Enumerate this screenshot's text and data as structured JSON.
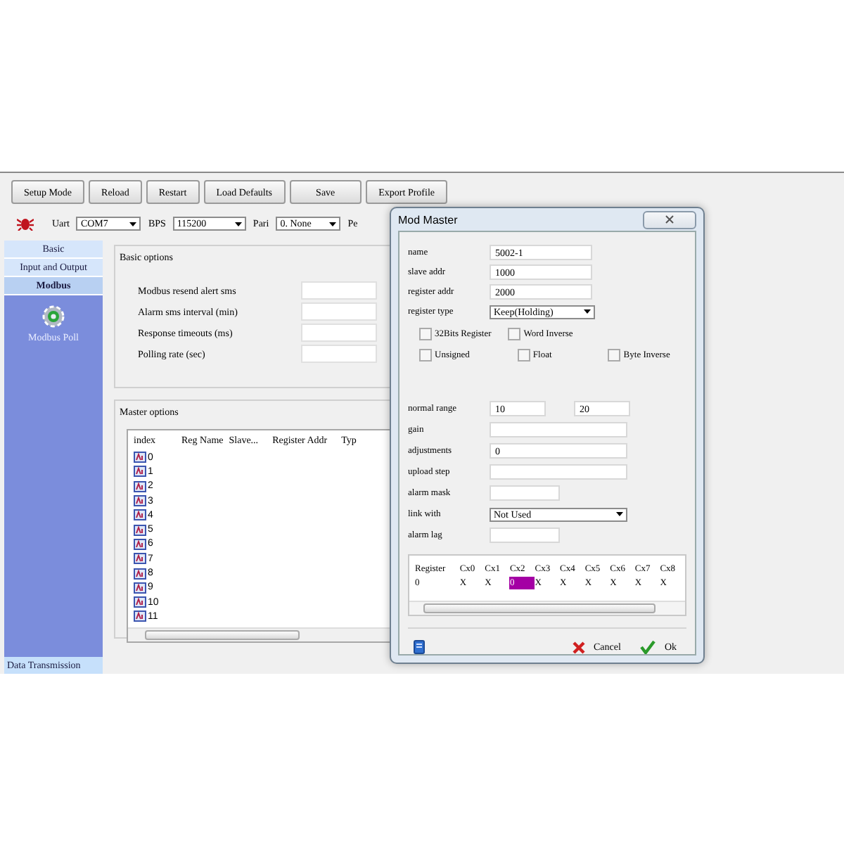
{
  "toolbar": {
    "buttons": [
      "Setup Mode",
      "Reload",
      "Restart",
      "Load Defaults",
      "Save",
      "Export Profile"
    ]
  },
  "port_row": {
    "fields": [
      {
        "label": "Uart",
        "value": "COM7",
        "kind": "select"
      },
      {
        "label": "BPS",
        "value": "115200",
        "kind": "select"
      },
      {
        "label": "Pari",
        "value": "0. None",
        "kind": "select"
      }
    ],
    "cut_label": "Pe"
  },
  "sidebar": {
    "items": [
      {
        "label": "Basic",
        "selected": false
      },
      {
        "label": "Input and Output",
        "selected": false
      },
      {
        "label": "Modbus",
        "selected": true
      }
    ],
    "tools": [
      {
        "label": "Modbus Poll"
      }
    ],
    "footer": "Data Transmission"
  },
  "basic_options": {
    "title": "Basic options",
    "fields": [
      {
        "label": "Modbus resend alert sms"
      },
      {
        "label": "Alarm sms interval (min)"
      },
      {
        "label": "Response timeouts (ms)"
      },
      {
        "label": "Polling rate (sec)"
      }
    ]
  },
  "master_options": {
    "title": "Master options",
    "columns": [
      "index",
      "Reg Name",
      "Slave...",
      "Register Addr",
      "Typ"
    ],
    "rows": [
      {
        "index": "0"
      },
      {
        "index": "1"
      },
      {
        "index": "2"
      },
      {
        "index": "3"
      },
      {
        "index": "4"
      },
      {
        "index": "5"
      },
      {
        "index": "6"
      },
      {
        "index": "7"
      },
      {
        "index": "8"
      },
      {
        "index": "9"
      },
      {
        "index": "10"
      },
      {
        "index": "11"
      }
    ]
  },
  "dialog": {
    "title": "Mod Master",
    "top_fields": [
      {
        "label": "name",
        "value": "5002-1",
        "kind": "text"
      },
      {
        "label": "slave addr",
        "value": "1000",
        "kind": "text"
      },
      {
        "label": "register addr",
        "value": "2000",
        "kind": "text"
      },
      {
        "label": "register type",
        "value": "Keep(Holding)",
        "kind": "select"
      }
    ],
    "options": [
      [
        {
          "label": "32Bits Register",
          "checked": false
        },
        {
          "label": "Word Inverse",
          "checked": false
        }
      ],
      [
        {
          "label": "Unsigned",
          "checked": false
        },
        {
          "label": "Float",
          "checked": false
        },
        {
          "label": "Byte Inverse",
          "checked": false
        }
      ]
    ],
    "bottom_fields": [
      {
        "label": "normal range",
        "values": [
          "10",
          "20"
        ],
        "kind": "range"
      },
      {
        "label": "gain",
        "kind": "text"
      },
      {
        "label": "adjustments",
        "value": "0",
        "kind": "text"
      },
      {
        "label": "upload step",
        "kind": "text"
      },
      {
        "label": "alarm mask",
        "kind": "short"
      },
      {
        "label": "link with",
        "value": "Not Used",
        "kind": "select"
      },
      {
        "label": "alarm lag",
        "kind": "short"
      }
    ],
    "grid": {
      "columns": [
        "Register",
        "Cx0",
        "Cx1",
        "Cx2",
        "Cx3",
        "Cx4",
        "Cx5",
        "Cx6",
        "Cx7",
        "Cx8"
      ],
      "rows": [
        {
          "cells": [
            {
              "text": "0",
              "selected": false
            },
            {
              "text": "X",
              "selected": false
            },
            {
              "text": "X",
              "selected": false
            },
            {
              "text": "0",
              "selected": true
            },
            {
              "text": "X",
              "selected": false
            },
            {
              "text": "X",
              "selected": false
            },
            {
              "text": "X",
              "selected": false
            },
            {
              "text": "X",
              "selected": false
            },
            {
              "text": "X",
              "selected": false
            },
            {
              "text": "X",
              "selected": false
            }
          ]
        }
      ]
    },
    "buttons": [
      {
        "label": "Cancel",
        "kind": "cancel"
      },
      {
        "label": "Ok",
        "kind": "ok"
      }
    ]
  }
}
